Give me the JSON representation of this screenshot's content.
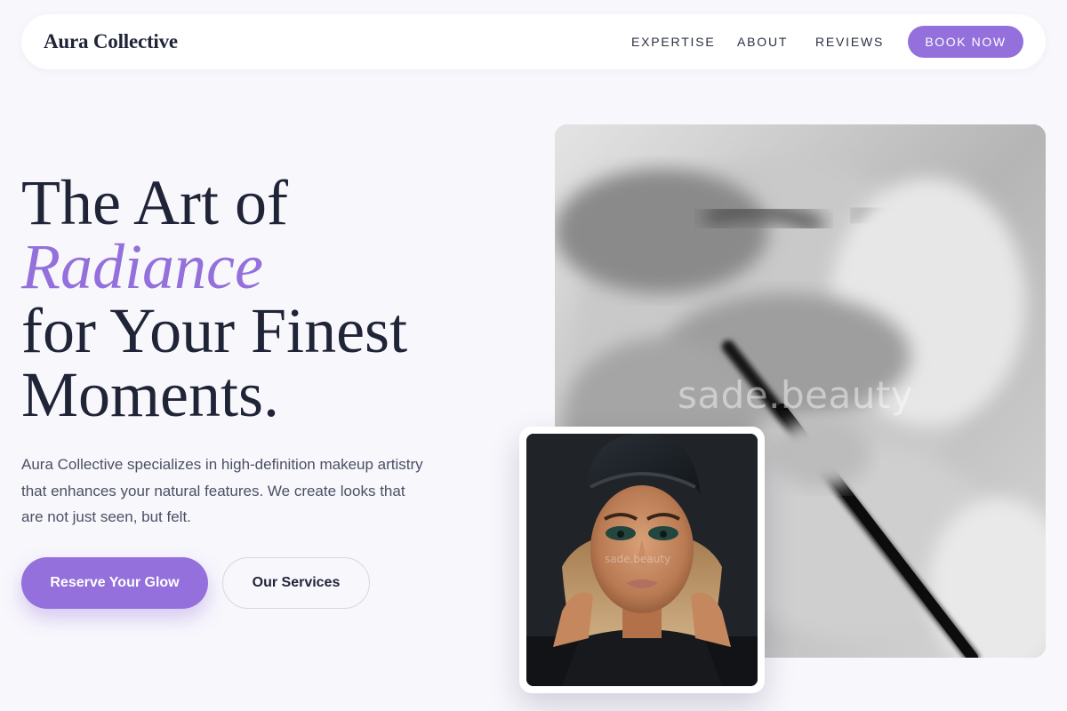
{
  "nav": {
    "brand": "Aura Collective",
    "links": [
      "EXPERTISE",
      "ABOUT",
      "REVIEWS"
    ],
    "cta": "BOOK NOW"
  },
  "hero": {
    "headline_line1": "The Art of",
    "headline_accent": "Radiance",
    "headline_line3": "for Your Finest",
    "headline_line4": "Moments.",
    "description": "Aura Collective specializes in high-definition makeup artistry that enhances your natural features. We create looks that are not just seen, but felt.",
    "primary_button": "Reserve Your Glow",
    "secondary_button": "Our Services"
  },
  "images": {
    "main_watermark": "sade.beauty",
    "portrait_watermark": "sade.beauty"
  },
  "colors": {
    "accent": "#9370db",
    "text_dark": "#1f2437",
    "background": "#f8f7fc"
  }
}
